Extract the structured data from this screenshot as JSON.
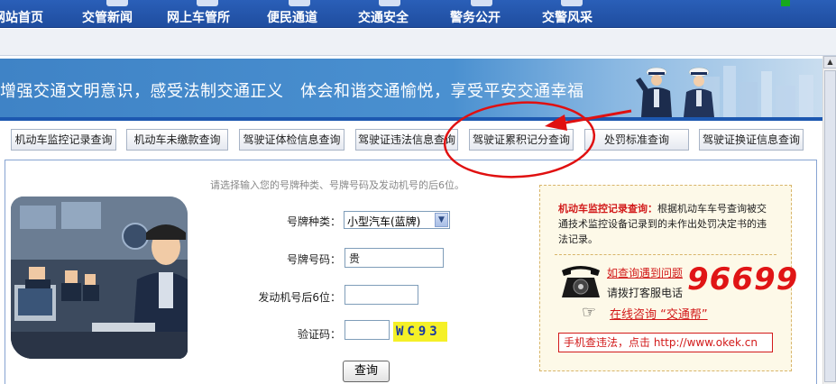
{
  "nav": {
    "items": [
      {
        "label": "网站首页"
      },
      {
        "label": "交管新闻"
      },
      {
        "label": "网上车管所"
      },
      {
        "label": "便民通道"
      },
      {
        "label": "交通安全"
      },
      {
        "label": "警务公开"
      },
      {
        "label": "交警风采"
      }
    ]
  },
  "banner": {
    "slogan": "增强交通文明意识，感受法制交通正义　体会和谐交通愉悦，享受平安交通幸福"
  },
  "tabs": [
    {
      "label": "机动车监控记录查询"
    },
    {
      "label": "机动车未缴款查询"
    },
    {
      "label": "驾驶证体检信息查询"
    },
    {
      "label": "驾驶证违法信息查询"
    },
    {
      "label": "驾驶证累积记分查询"
    },
    {
      "label": "处罚标准查询"
    },
    {
      "label": "驾驶证换证信息查询"
    }
  ],
  "form": {
    "hint": "请选择输入您的号牌种类、号牌号码及发动机号的后6位。",
    "plate_type_label": "号牌种类：",
    "plate_type_value": "小型汽车(蓝牌)",
    "plate_number_label": "号牌号码：",
    "plate_number_value": "贵",
    "engine_label": "发动机号后6位：",
    "engine_value": "",
    "captcha_label": "验证码：",
    "captcha_value": "",
    "captcha_text": "WC93",
    "submit_label": "查询"
  },
  "info": {
    "title": "机动车监控记录查询：",
    "description": "根据机动车车号查询被交通技术监控设备记录到的未作出处罚决定书的违法记录。",
    "problem_text": "如查询遇到问题",
    "dial_text": "请拨打客服电话",
    "hotline": "96699",
    "online_text": "在线咨询 “交通帮”",
    "mobile_text": "手机查违法，点击 http://www.okek.cn"
  },
  "colors": {
    "nav_bg": "#2a5fb8",
    "banner_bg": "#4a90d0",
    "accent_red": "#e01515",
    "annotation_red": "#e01010"
  }
}
